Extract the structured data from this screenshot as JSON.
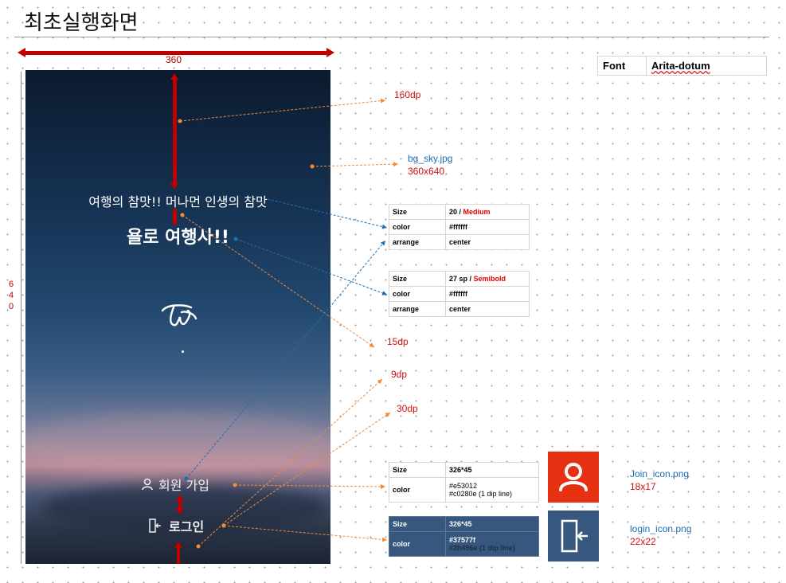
{
  "page_title": "최초실행화면",
  "dimensions": {
    "width": "360",
    "height_digits": [
      "6",
      "4",
      "0"
    ]
  },
  "font_table": {
    "label": "Font",
    "value": "Arita-dotum"
  },
  "phone": {
    "line1": "여행의 참맛!! 머나먼 인생의 참맛",
    "line2": "욜로 여행사!!",
    "join_label": "회원 가입",
    "login_label": "로그인",
    "logo": "twice-logo"
  },
  "notes": {
    "top_margin": "160dp",
    "bg_name": "bg_sky.jpg",
    "bg_size": "360x640",
    "gap_text": "15dp",
    "gap_buttons": "9dp",
    "bottom": "30dp",
    "join_icon_name": "Join_icon.png",
    "join_icon_size": "18x17",
    "login_icon_name": "login_icon.png",
    "login_icon_size": "22x22"
  },
  "specs": {
    "text1": {
      "size_label": "Size",
      "size_value": "20",
      "size_sep": " / ",
      "size_weight": "Medium",
      "color_label": "color",
      "color_value": "#ffffff",
      "arrange_label": "arrange",
      "arrange_value": "center"
    },
    "text2": {
      "size_label": "Size",
      "size_value": "27 sp",
      "size_sep": " / ",
      "size_weight": "Semibold",
      "color_label": "color",
      "color_value": "#ffffff",
      "arrange_label": "arrange",
      "arrange_value": "center"
    },
    "join_btn": {
      "size_label": "Size",
      "size_value": "326*45",
      "color_label": "color",
      "color_value_1": "#e53012",
      "color_value_2": "#c0280e (1 dip  line)"
    },
    "login_btn": {
      "size_label": "Size",
      "size_value": "326*45",
      "color_label": "color",
      "color_value_1": "#37577f",
      "color_value_2": "#2h496e (1 dip  line)"
    }
  },
  "colors": {
    "accent_red": "#c00000",
    "join": "#e53012",
    "login": "#37577f",
    "note_orange": "#f08a3c",
    "note_blue": "#1f6fb2"
  },
  "icons": [
    "user-icon",
    "door-exit-icon"
  ]
}
